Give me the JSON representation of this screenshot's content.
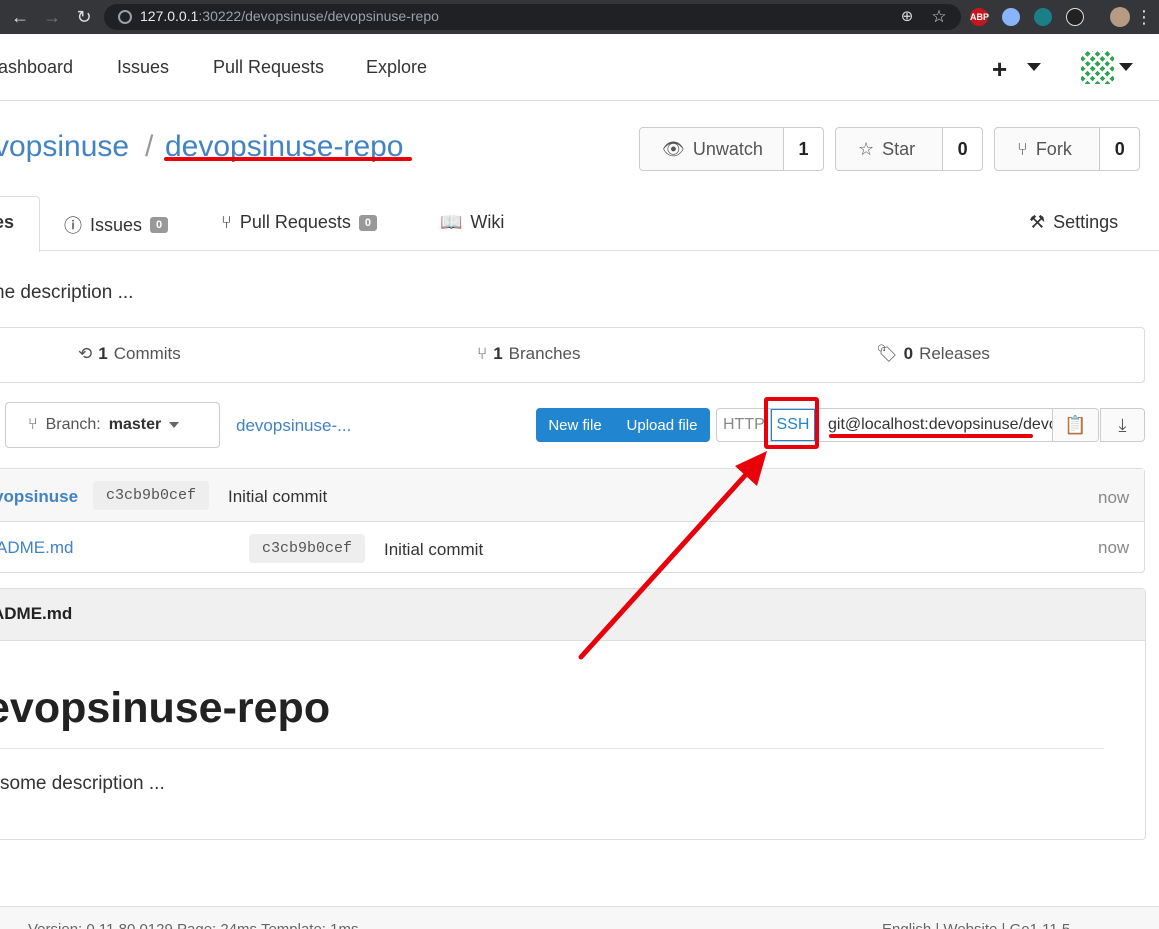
{
  "browser": {
    "url_host": "127.0.0.1",
    "url_rest": ":30222/devopsinuse/devopsinuse-repo",
    "ext_abp": "ABP"
  },
  "nav": {
    "dashboard": "ashboard",
    "issues": "Issues",
    "pull_requests": "Pull Requests",
    "explore": "Explore",
    "plus": "+"
  },
  "repo": {
    "owner": "vopsinuse",
    "separator": "/",
    "name": "devopsinuse-repo",
    "unwatch_label": "Unwatch",
    "unwatch_count": "1",
    "star_label": "Star",
    "star_count": "0",
    "fork_label": "Fork",
    "fork_count": "0"
  },
  "tabs": {
    "files": "es",
    "issues": "Issues",
    "issues_count": "0",
    "pull_requests": "Pull Requests",
    "pull_requests_count": "0",
    "wiki": "Wiki",
    "settings": "Settings"
  },
  "description": "ne description ...",
  "stats": {
    "commits_count": "1",
    "commits_label": "Commits",
    "branches_count": "1",
    "branches_label": "Branches",
    "releases_count": "0",
    "releases_label": "Releases"
  },
  "toolbar": {
    "branch_label": "Branch:",
    "branch_value": "master",
    "breadcrumb": "devopsinuse-...",
    "new_file": "New file",
    "upload_file": "Upload file",
    "http": "HTTP",
    "ssh": "SSH",
    "clone_url": "git@localhost:devopsinuse/devopsinuse-repo.git"
  },
  "commit_header": {
    "author": "vopsinuse",
    "sha": "c3cb9b0cef",
    "message": "Initial commit",
    "time": "now"
  },
  "files": [
    {
      "name": "ADME.md",
      "sha": "c3cb9b0cef",
      "message": "Initial commit",
      "time": "now"
    }
  ],
  "readme": {
    "title": "ADME.md",
    "heading": "evopsinuse-repo",
    "body": "some description ..."
  },
  "footer": {
    "left": "Version: 0.11.80.0129 Page: 24ms Template: 1ms",
    "right": "English | Website | Go1.11.5"
  },
  "colors": {
    "accent": "#2185d0",
    "link": "#4183c4",
    "annotation": "#e8000b"
  }
}
